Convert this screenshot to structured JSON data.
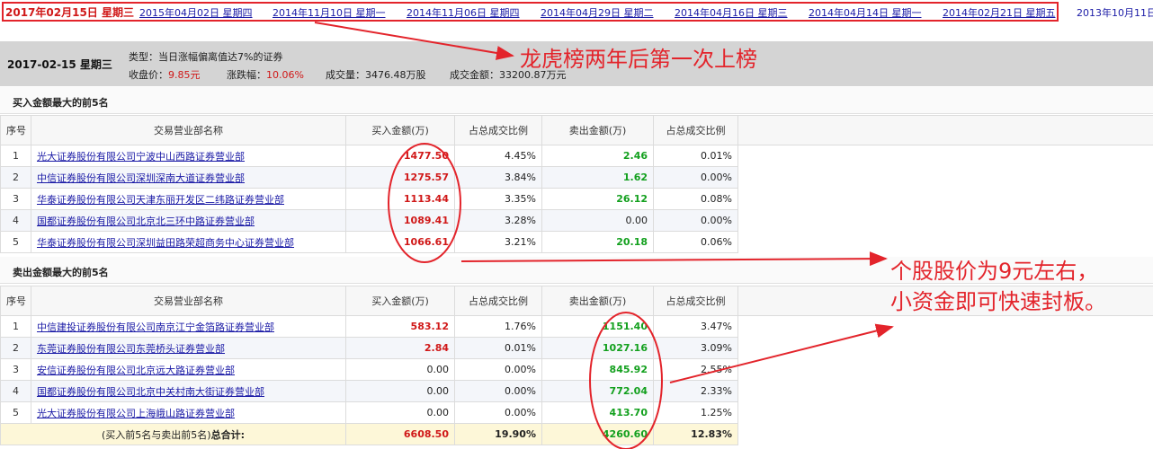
{
  "date_tabs": [
    {
      "date": "2017年02月15日",
      "weekday": "星期三",
      "active": true
    },
    {
      "date": "2015年04月02日",
      "weekday": "星期四"
    },
    {
      "date": "2014年11月10日",
      "weekday": "星期一"
    },
    {
      "date": "2014年11月06日",
      "weekday": "星期四"
    },
    {
      "date": "2014年04月29日",
      "weekday": "星期二"
    },
    {
      "date": "2014年04月16日",
      "weekday": "星期三"
    },
    {
      "date": "2014年04月14日",
      "weekday": "星期一"
    },
    {
      "date": "2014年02月21日",
      "weekday": "星期五"
    },
    {
      "date": "2013年10月11日",
      "weekday": ""
    }
  ],
  "info": {
    "date_label": "2017-02-15 星期三",
    "type_label": "类型：",
    "type_value": "当日涨幅偏离值达7%的证券",
    "close_label": "收盘价：",
    "close_value": "9.85元",
    "change_label": "涨跌幅：",
    "change_value": "10.06%",
    "volume_label": "成交量：",
    "volume_value": "3476.48万股",
    "amount_label": "成交金额：",
    "amount_value": "33200.87万元"
  },
  "buy_section": {
    "title": "买入金额最大的前5名",
    "headers": [
      "序号",
      "交易营业部名称",
      "买入金额(万)",
      "占总成交比例",
      "卖出金额(万)",
      "占总成交比例"
    ],
    "rows": [
      {
        "seq": "1",
        "name": "光大证券股份有限公司宁波中山西路证券营业部",
        "buy": "1477.50",
        "buy_pct": "4.45%",
        "sell": "2.46",
        "sell_pct": "0.01%"
      },
      {
        "seq": "2",
        "name": "中信证券股份有限公司深圳深南大道证券营业部",
        "buy": "1275.57",
        "buy_pct": "3.84%",
        "sell": "1.62",
        "sell_pct": "0.00%"
      },
      {
        "seq": "3",
        "name": "华泰证券股份有限公司天津东丽开发区二纬路证券营业部",
        "buy": "1113.44",
        "buy_pct": "3.35%",
        "sell": "26.12",
        "sell_pct": "0.08%"
      },
      {
        "seq": "4",
        "name": "国都证券股份有限公司北京北三环中路证券营业部",
        "buy": "1089.41",
        "buy_pct": "3.28%",
        "sell": "0.00",
        "sell_pct": "0.00%"
      },
      {
        "seq": "5",
        "name": "华泰证券股份有限公司深圳益田路荣超商务中心证券营业部",
        "buy": "1066.61",
        "buy_pct": "3.21%",
        "sell": "20.18",
        "sell_pct": "0.06%"
      }
    ]
  },
  "sell_section": {
    "title": "卖出金额最大的前5名",
    "headers": [
      "序号",
      "交易营业部名称",
      "买入金额(万)",
      "占总成交比例",
      "卖出金额(万)",
      "占总成交比例"
    ],
    "rows": [
      {
        "seq": "1",
        "name": "中信建投证券股份有限公司南京江宁金箔路证券营业部",
        "buy": "583.12",
        "buy_pct": "1.76%",
        "sell": "1151.40",
        "sell_pct": "3.47%"
      },
      {
        "seq": "2",
        "name": "东莞证券股份有限公司东莞桥头证券营业部",
        "buy": "2.84",
        "buy_pct": "0.01%",
        "sell": "1027.16",
        "sell_pct": "3.09%"
      },
      {
        "seq": "3",
        "name": "安信证券股份有限公司北京远大路证券营业部",
        "buy": "0.00",
        "buy_pct": "0.00%",
        "sell": "845.92",
        "sell_pct": "2.55%"
      },
      {
        "seq": "4",
        "name": "国都证券股份有限公司北京中关村南大街证券营业部",
        "buy": "0.00",
        "buy_pct": "0.00%",
        "sell": "772.04",
        "sell_pct": "2.33%"
      },
      {
        "seq": "5",
        "name": "光大证券股份有限公司上海峨山路证券营业部",
        "buy": "0.00",
        "buy_pct": "0.00%",
        "sell": "413.70",
        "sell_pct": "1.25%"
      }
    ],
    "total": {
      "label_prefix": "(买入前5名与卖出前5名)",
      "label_bold": "总合计:",
      "buy": "6608.50",
      "buy_pct": "19.90%",
      "sell": "4260.60",
      "sell_pct": "12.83%"
    }
  },
  "annotations": {
    "top": "龙虎榜两年后第一次上榜",
    "right_line1": "个股股价为9元左右，",
    "right_line2": "小资金即可快速封板。"
  },
  "colors": {
    "annotation_red": "#e3242b",
    "buy_red": "#d01818",
    "sell_green": "#13a01e",
    "link_blue": "#1a1aa6",
    "info_band": "#d4d4d4"
  }
}
